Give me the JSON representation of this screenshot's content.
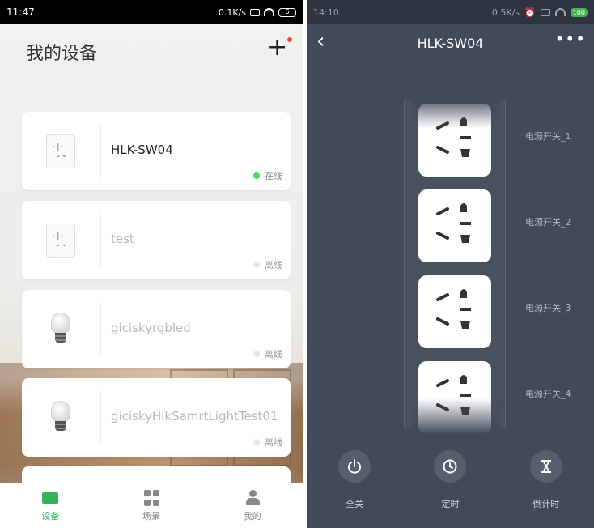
{
  "left": {
    "status_bar": {
      "time": "11:47",
      "speed": "0.1K/s",
      "battery": "6"
    },
    "title": "我的设备",
    "add_label": "+",
    "devices": [
      {
        "name": "HLK-SW04",
        "status": "在线",
        "online": true,
        "kind": "socket"
      },
      {
        "name": "test",
        "status": "离线",
        "online": false,
        "kind": "socket"
      },
      {
        "name": "giciskyrgbled",
        "status": "离线",
        "online": false,
        "kind": "bulb"
      },
      {
        "name": "giciskyHlkSamrtLightTest01",
        "status": "离线",
        "online": false,
        "kind": "bulb"
      }
    ],
    "tabs": [
      {
        "label": "设备",
        "icon": "device-icon",
        "active": true
      },
      {
        "label": "场景",
        "icon": "scene-icon",
        "active": false
      },
      {
        "label": "我的",
        "icon": "profile-icon",
        "active": false
      }
    ],
    "colors": {
      "accent": "#34b35a",
      "online": "#4cd964",
      "offline": "#e3e3e3"
    }
  },
  "right": {
    "status_bar": {
      "time": "14:10",
      "speed": "0.5K/s",
      "battery": "100"
    },
    "title": "HLK-SW04",
    "back_label": "‹",
    "more_label": "•••",
    "switches": [
      {
        "label": "电源开关_1"
      },
      {
        "label": "电源开关_2"
      },
      {
        "label": "电源开关_3"
      },
      {
        "label": "电源开关_4"
      }
    ],
    "actions": [
      {
        "label": "全关",
        "icon": "power-icon"
      },
      {
        "label": "定时",
        "icon": "clock-icon"
      },
      {
        "label": "倒计时",
        "icon": "hourglass-icon"
      }
    ],
    "colors": {
      "background": "#424a59"
    }
  }
}
